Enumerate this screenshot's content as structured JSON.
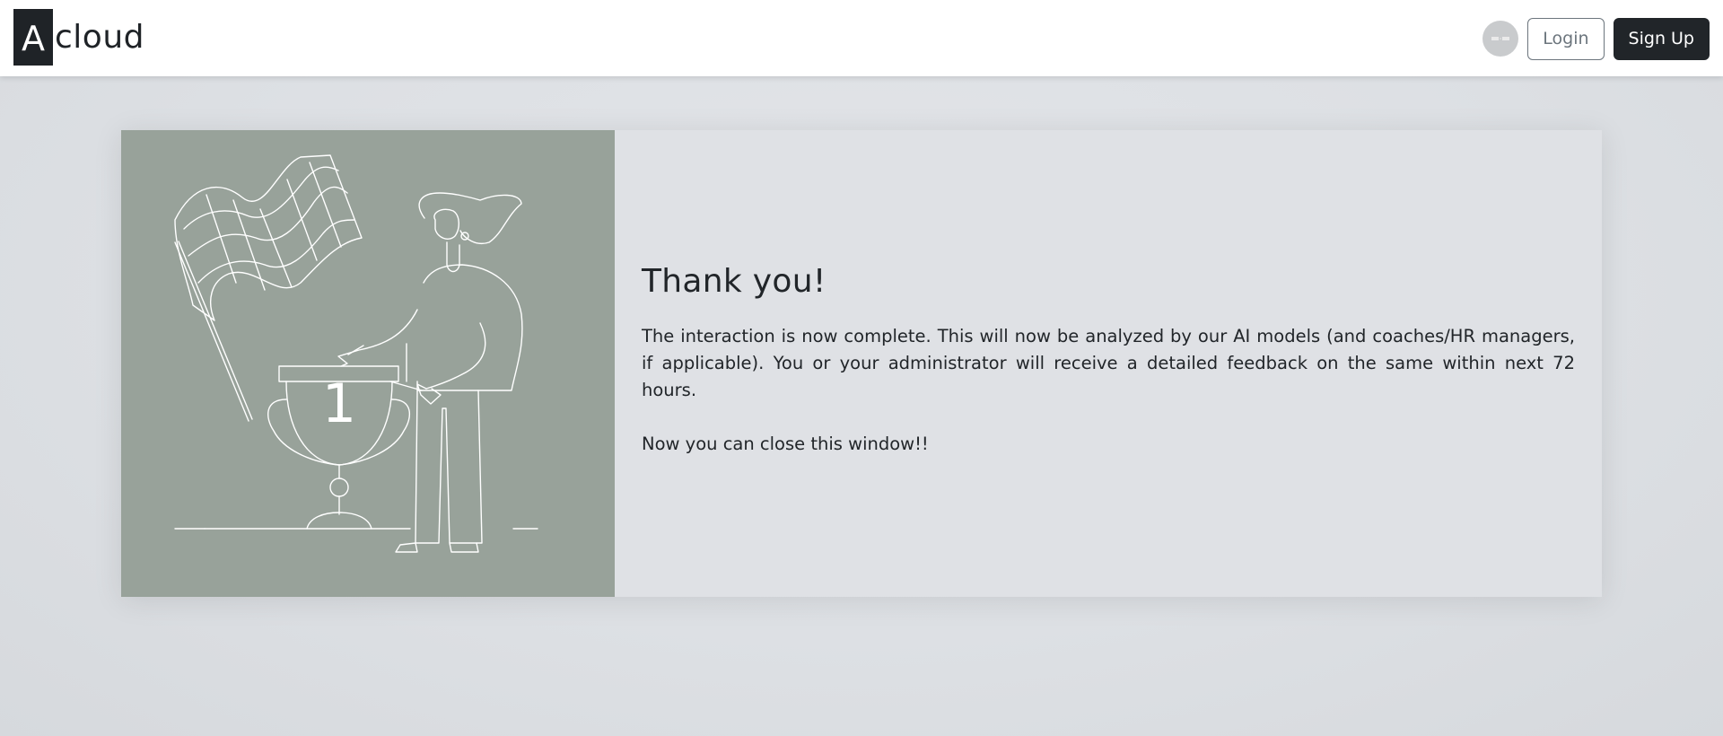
{
  "header": {
    "logo_mark": "A",
    "logo_word": "cloud",
    "language_toggle": "  ",
    "login_label": "Login",
    "signup_label": "Sign Up"
  },
  "card": {
    "title": "Thank you!",
    "message": "The interaction is now complete. This will now be analyzed by our AI models (and coaches/HR managers, if applicable). You or your administrator will receive a detailed feedback on the same within next 72 hours.",
    "close_note": "Now you can close this window!!",
    "illustration": {
      "trophy_number": "1",
      "icons": [
        "checkered-flag-icon",
        "trophy-icon",
        "person-icon"
      ]
    }
  },
  "colors": {
    "header_bg": "#ffffff",
    "page_bg": "#dcdfe3",
    "illustration_bg": "#98a29a",
    "card_bg": "#dfe1e5",
    "primary_dark": "#212529",
    "outline_gray": "#6c757d"
  }
}
